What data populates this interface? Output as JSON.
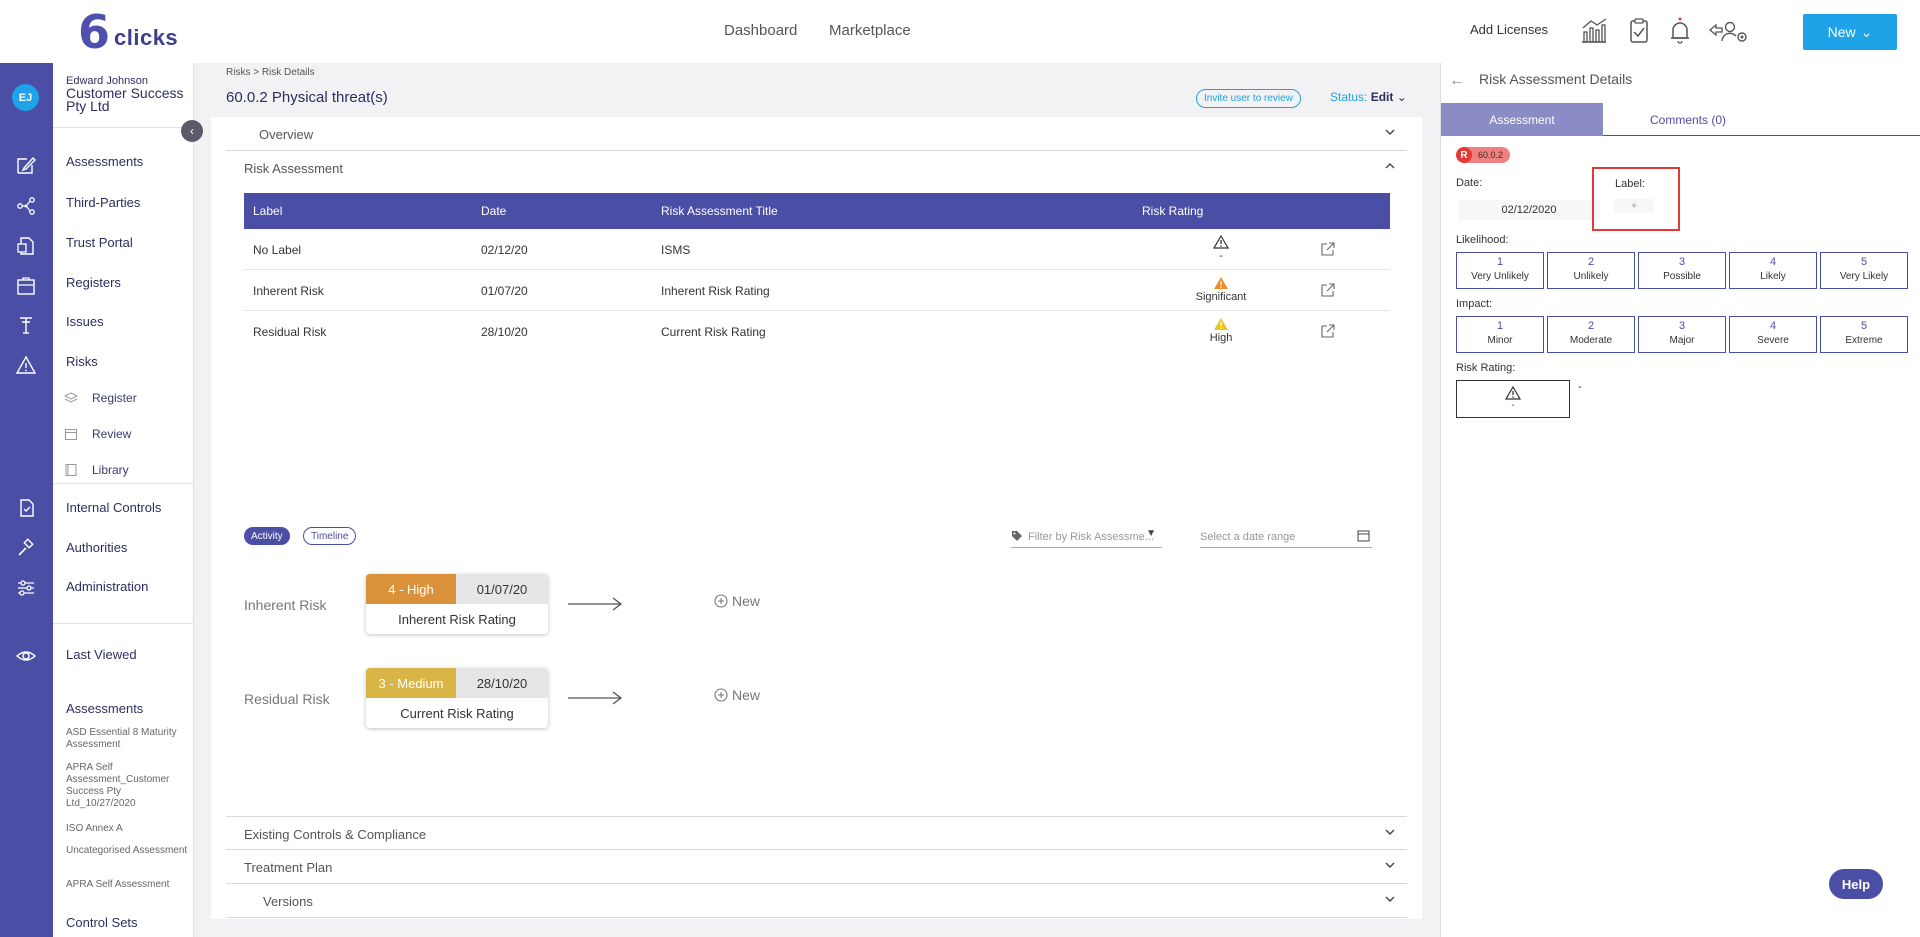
{
  "brand": {
    "logo_mark": "6",
    "logo_word": "clicks"
  },
  "topnav": {
    "dashboard": "Dashboard",
    "marketplace": "Marketplace"
  },
  "header_right": {
    "add_licenses": "Add Licenses",
    "new_button": "New",
    "icons": [
      "analytics-icon",
      "tasks-icon",
      "notifications-icon",
      "user-settings-icon"
    ]
  },
  "user": {
    "initials": "EJ",
    "name": "Edward Johnson",
    "org": "Customer Success Pty Ltd"
  },
  "sidebar": {
    "items": [
      "Assessments",
      "Third-Parties",
      "Trust Portal",
      "Registers",
      "Issues",
      "Risks"
    ],
    "sub_items": [
      "Register",
      "Review",
      "Library"
    ],
    "items2": [
      "Internal Controls",
      "Authorities",
      "Administration"
    ],
    "last_viewed": "Last Viewed",
    "recent_heading": "Assessments",
    "recent": [
      "ASD Essential 8 Maturity Assessment",
      "APRA Self Assessment_Customer Success Pty Ltd_10/27/2020",
      "ISO Annex A",
      "Uncategorised Assessment",
      "APRA Self Assessment"
    ],
    "control_sets": "Control Sets"
  },
  "page": {
    "breadcrumb": "Risks >  Risk Details",
    "title": "60.0.2 Physical threat(s)",
    "invite": "Invite user to review",
    "status_label": "Status:",
    "status_value": "Edit"
  },
  "sections": {
    "overview": "Overview",
    "risk_assessment": "Risk Assessment",
    "existing_controls": "Existing Controls & Compliance",
    "treatment_plan": "Treatment Plan",
    "versions": "Versions"
  },
  "risk_table": {
    "headers": [
      "Label",
      "Date",
      "Risk Assessment Title",
      "Risk Rating"
    ],
    "rows": [
      {
        "label": "No Label",
        "date": "02/12/20",
        "title": "ISMS",
        "rating": "-",
        "icon_color": "#333333"
      },
      {
        "label": "Inherent Risk",
        "date": "01/07/20",
        "title": "Inherent Risk Rating",
        "rating": "Significant",
        "icon_color": "#f28c28"
      },
      {
        "label": "Residual Risk",
        "date": "28/10/20",
        "title": "Current Risk Rating",
        "rating": "High",
        "icon_color": "#e6c619"
      }
    ]
  },
  "timeline": {
    "tab_activity": "Activity",
    "tab_timeline": "Timeline",
    "filter_placeholder": "Filter by Risk Assessme...",
    "date_placeholder": "Select a date range",
    "entries": [
      {
        "label": "Inherent Risk",
        "level": "4 - High",
        "level_color": "#d9913a",
        "date": "01/07/20",
        "title": "Inherent Risk Rating",
        "new_label": "New"
      },
      {
        "label": "Residual Risk",
        "level": "3 - Medium",
        "level_color": "#d9b446",
        "date": "28/10/20",
        "title": "Current Risk Rating",
        "new_label": "New"
      }
    ]
  },
  "right_panel": {
    "title": "Risk Assessment Details",
    "tab_assessment": "Assessment",
    "tab_comments": "Comments (0)",
    "badge_letter": "R",
    "badge_code": "60.0.2",
    "date_label": "Date:",
    "date_value": "02/12/2020",
    "label_label": "Label:",
    "label_add": "+",
    "likelihood_label": "Likelihood:",
    "likelihood": [
      {
        "n": "1",
        "w": "Very Unlikely"
      },
      {
        "n": "2",
        "w": "Unlikely"
      },
      {
        "n": "3",
        "w": "Possible"
      },
      {
        "n": "4",
        "w": "Likely"
      },
      {
        "n": "5",
        "w": "Very Likely"
      }
    ],
    "impact_label": "Impact:",
    "impact": [
      {
        "n": "1",
        "w": "Minor"
      },
      {
        "n": "2",
        "w": "Moderate"
      },
      {
        "n": "3",
        "w": "Major"
      },
      {
        "n": "4",
        "w": "Severe"
      },
      {
        "n": "5",
        "w": "Extreme"
      }
    ],
    "risk_rating_label": "Risk Rating:",
    "risk_rating_value": "-",
    "risk_rating_side": "-"
  },
  "help": "Help"
}
